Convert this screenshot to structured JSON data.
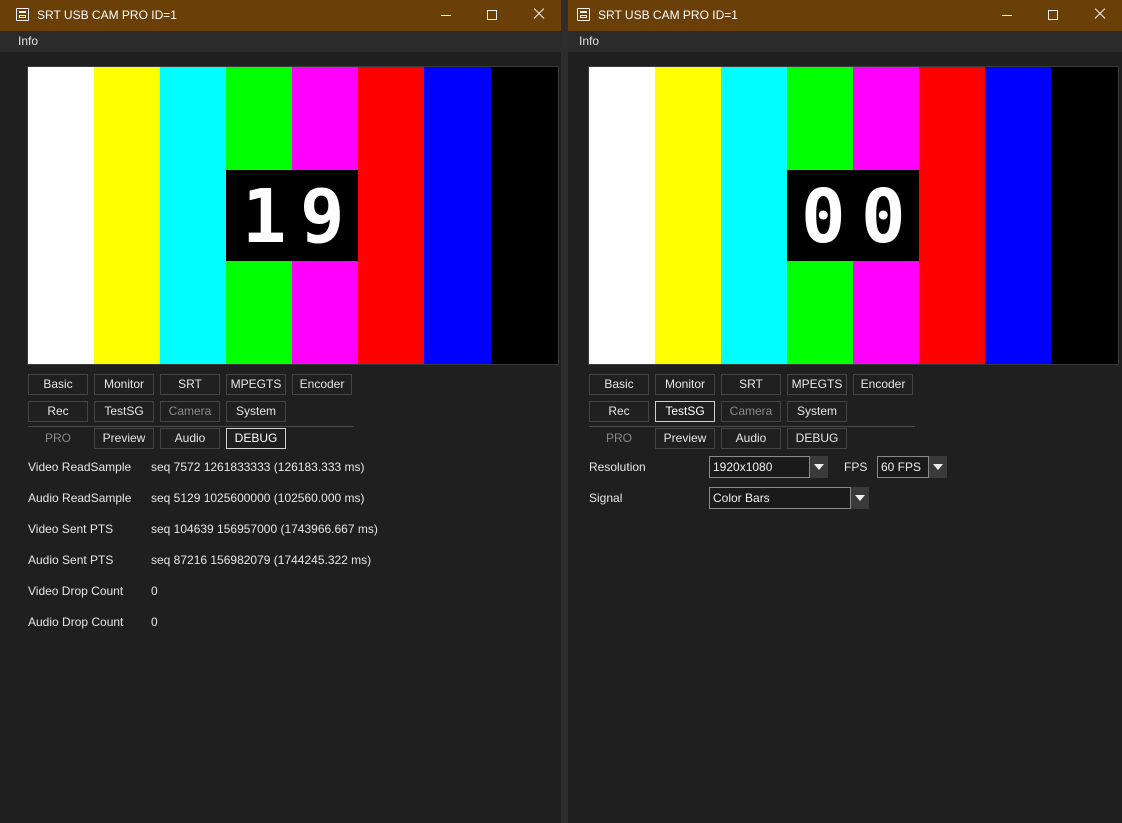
{
  "windows": {
    "left": {
      "title": "SRT USB CAM PRO ID=1",
      "menu_info": "Info",
      "counter": [
        "1",
        "9"
      ],
      "tabs_row1": [
        "Basic",
        "Monitor",
        "SRT",
        "MPEGTS",
        "Encoder"
      ],
      "tabs_row2": [
        "Rec",
        "TestSG",
        "Camera",
        "System"
      ],
      "tabs_row3": [
        "PRO",
        "Preview",
        "Audio",
        "DEBUG"
      ],
      "selected_tab": "DEBUG",
      "debug_rows": [
        {
          "label": "Video ReadSample",
          "value": "seq 7572  1261833333 (126183.333 ms)"
        },
        {
          "label": "Audio ReadSample",
          "value": "seq 5129  1025600000 (102560.000 ms)"
        },
        {
          "label": "Video Sent PTS",
          "value": "seq 104639  156957000 (1743966.667 ms)"
        },
        {
          "label": "Audio Sent PTS",
          "value": "seq 87216  156982079 (1744245.322 ms)"
        },
        {
          "label": "Video Drop Count",
          "value": "0"
        },
        {
          "label": "Audio Drop Count",
          "value": "0"
        }
      ]
    },
    "right": {
      "title": "SRT USB CAM PRO ID=1",
      "menu_info": "Info",
      "counter": [
        "0",
        "0"
      ],
      "tabs_row1": [
        "Basic",
        "Monitor",
        "SRT",
        "MPEGTS",
        "Encoder"
      ],
      "tabs_row2": [
        "Rec",
        "TestSG",
        "Camera",
        "System"
      ],
      "tabs_row3": [
        "PRO",
        "Preview",
        "Audio",
        "DEBUG"
      ],
      "selected_tab": "TestSG",
      "resolution_label": "Resolution",
      "resolution_value": "1920x1080",
      "fps_label": "FPS",
      "fps_value": "60 FPS",
      "signal_label": "Signal",
      "signal_value": "Color Bars"
    }
  },
  "colors": {
    "titlebar": "#6b3f08",
    "color_bars": [
      "#ffffff",
      "#ffff00",
      "#00ffff",
      "#00ff00",
      "#ff00ff",
      "#ff0000",
      "#0000ff",
      "#000000"
    ]
  },
  "icons": [
    "app-window-icon",
    "minimize-icon",
    "maximize-icon",
    "close-icon",
    "dropdown-arrow-icon"
  ]
}
